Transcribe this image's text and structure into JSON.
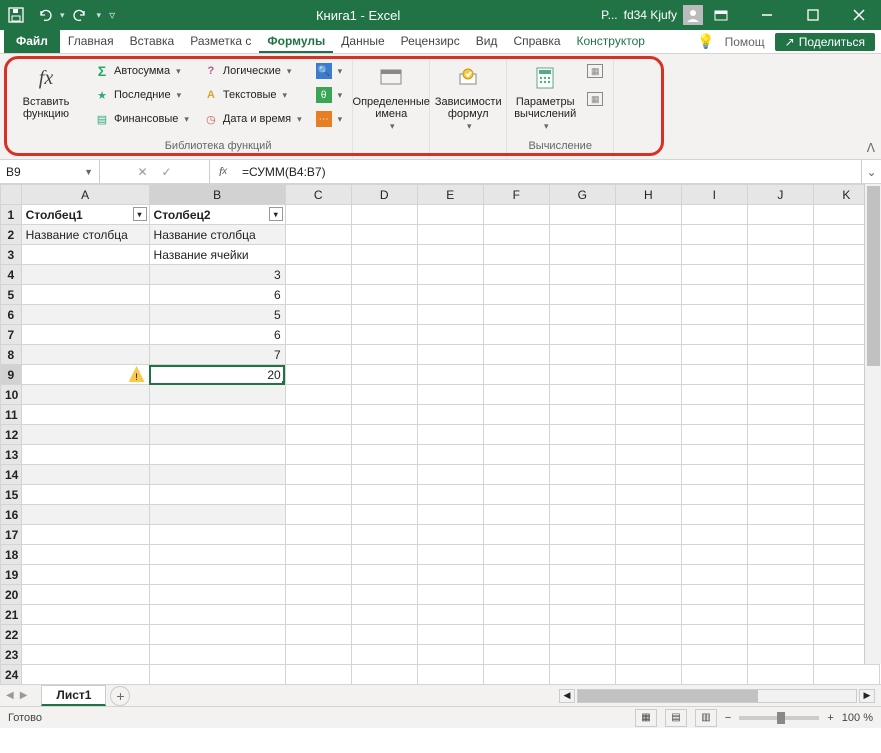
{
  "title": "Книга1 - Excel",
  "user": {
    "pending": "P...",
    "name": "fd34 Kjufy"
  },
  "tabs": {
    "file": "Файл",
    "items": [
      "Главная",
      "Вставка",
      "Разметка с",
      "Формулы",
      "Данные",
      "Рецензирс",
      "Вид",
      "Справка"
    ],
    "selected": "Формулы",
    "context": "Конструктор",
    "help": "Помощ",
    "share": "Поделиться"
  },
  "ribbon": {
    "insert_fn": {
      "label": "Вставить\nфункцию"
    },
    "library": {
      "autosum": "Автосумма",
      "recent": "Последние",
      "financial": "Финансовые",
      "logical": "Логические",
      "text": "Текстовые",
      "datetime": "Дата и время",
      "label": "Библиотека функций"
    },
    "defined_names": "Определенные\nимена",
    "formula_auditing": "Зависимости\nформул",
    "calc_options": "Параметры\nвычислений",
    "calc_group": "Вычисление"
  },
  "namebox": "B9",
  "formula": "=СУММ(B4:B7)",
  "columns": [
    "A",
    "B",
    "C",
    "D",
    "E",
    "F",
    "G",
    "H",
    "I",
    "J",
    "K"
  ],
  "row_count": 24,
  "table": {
    "headers": [
      "Столбец1",
      "Столбец2"
    ],
    "rows": [
      [
        "Название столбца",
        "Название столбца"
      ],
      [
        "",
        "Название ячейки"
      ],
      [
        "",
        "3"
      ],
      [
        "",
        "6"
      ],
      [
        "",
        "5"
      ],
      [
        "",
        "6"
      ],
      [
        "",
        "7"
      ],
      [
        "",
        "20"
      ]
    ],
    "numeric_from_row": 3,
    "selected_cell": {
      "row": 9,
      "col": "B"
    },
    "warning_cell": {
      "row": 9,
      "col": "A"
    }
  },
  "sheet_tab": "Лист1",
  "status": "Готово",
  "zoom": "100 %"
}
